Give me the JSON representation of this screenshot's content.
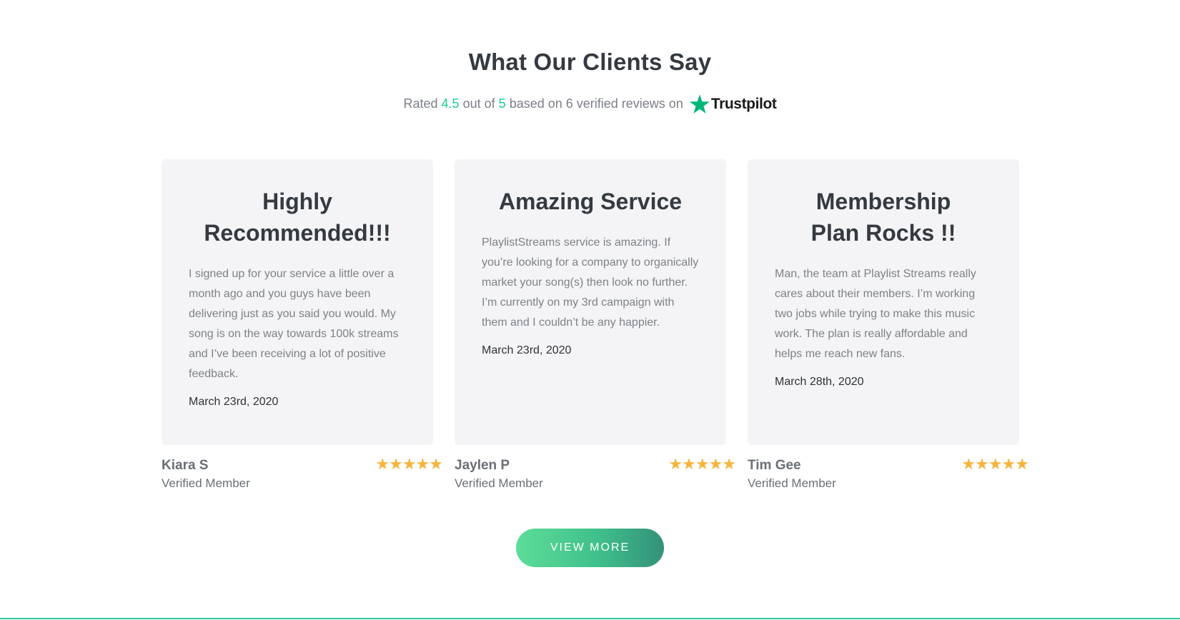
{
  "section": {
    "title": "What Our Clients Say",
    "rating": {
      "prefix": "Rated",
      "score": "4.5",
      "middle": "out of",
      "max": "5",
      "suffix": "based on 6 verified reviews on",
      "platform": "Trustpilot"
    }
  },
  "reviews": [
    {
      "title": "Highly Recommended!!!",
      "text": "I signed up for your service a little over a month ago and you guys have been delivering just as you said you would. My song is on the way towards 100k streams and I’ve been receiving a lot of positive feedback.",
      "date": "March 23rd, 2020",
      "author": "Kiara S",
      "role": "Verified Member",
      "stars": "★★★★★",
      "rating": 5
    },
    {
      "title": "Amazing Service",
      "text": "PlaylistStreams service is amazing. If you’re looking for a company to organically market your song(s) then look no further. I’m currently on my 3rd campaign with them and I couldn’t be any happier.",
      "date": "March 23rd, 2020",
      "author": "Jaylen P",
      "role": "Verified Member",
      "stars": "★★★★★",
      "rating": 5
    },
    {
      "title": "Membership Plan Rocks !!",
      "text": "Man, the team at Playlist Streams really cares about their members. I’m working two jobs while trying to make this music work. The plan is really affordable and helps me reach new fans.",
      "date": "March 28th, 2020",
      "author": "Tim Gee",
      "role": "Verified Member",
      "stars": "★★★★★",
      "rating": 5
    }
  ],
  "cta": {
    "label": "VIEW MORE"
  },
  "colors": {
    "accent": "#1fcf8d",
    "star": "#f6b43c",
    "card_bg": "#f4f4f6",
    "trustpilot_star": "#00b67a",
    "button_gradient_start": "#5ddd98",
    "button_gradient_end": "#34917a"
  },
  "icons": {
    "trustpilot_logo": "trustpilot-star-icon",
    "rating_star": "star-icon"
  }
}
